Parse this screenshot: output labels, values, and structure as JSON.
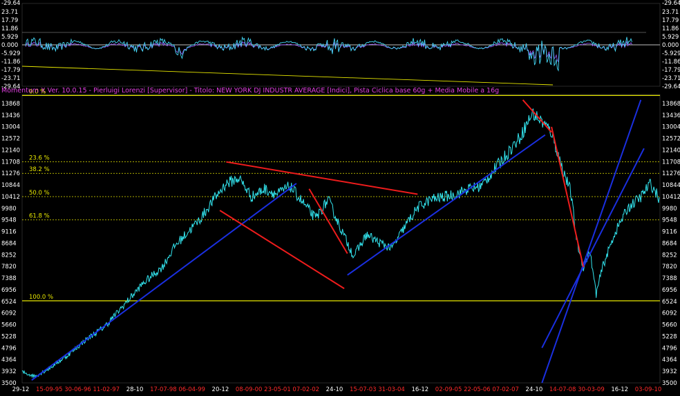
{
  "header": {
    "title": "Momentum X  Ver. 10.0.15  -  Pierluigi Lorenzi  [Supervisor] - Titolo: NEW YORK DJ INDUSTR AVERAGE  [Indici],    Pista Ciclica base 60g + Media Mobile a 16g"
  },
  "colors": {
    "background": "#000000",
    "price": "#33e6f0",
    "trend_blue": "#1a2fe0",
    "trend_red": "#ee1c1c",
    "fib_yellow": "#e8e800",
    "oscillator": "#44d7f5",
    "oscillator_accent": "#9b59ff",
    "label_magenta": "#e040e0",
    "axis_text": "#ffffff",
    "date_red": "#ff2a2a"
  },
  "chart_data": [
    {
      "name": "oscillator",
      "type": "line",
      "yticks": [
        "-29.64",
        "23.71",
        "17.79",
        "11.86",
        "5.929",
        "0.000",
        "-5.929",
        "-11.86",
        "-17.79",
        "-23.71",
        "-29.64"
      ],
      "ylim": [
        -29.64,
        29.64
      ]
    },
    {
      "name": "price",
      "type": "line",
      "yticks": [
        3500,
        3932,
        4364,
        4796,
        5228,
        5660,
        6092,
        6524,
        6956,
        7388,
        7820,
        8252,
        8684,
        9116,
        9548,
        9980,
        10412,
        10844,
        11276,
        11708,
        12140,
        12572,
        13004,
        13436,
        13868
      ],
      "ylim": [
        3500,
        14200
      ],
      "xticks": [
        {
          "label": "29-12",
          "color": "white"
        },
        {
          "label": "15-09-95",
          "color": "red"
        },
        {
          "label": "30-06-96",
          "color": "red"
        },
        {
          "label": "11-02-97",
          "color": "red"
        },
        {
          "label": "28-10",
          "color": "white"
        },
        {
          "label": "17-07-98",
          "color": "red"
        },
        {
          "label": "06-04-99",
          "color": "red"
        },
        {
          "label": "20-12",
          "color": "white"
        },
        {
          "label": "08-09-00",
          "color": "red"
        },
        {
          "label": "23-05-01",
          "color": "red"
        },
        {
          "label": "07-02-02",
          "color": "red"
        },
        {
          "label": "24-10",
          "color": "white"
        },
        {
          "label": "15-07-03",
          "color": "red"
        },
        {
          "label": "31-03-04",
          "color": "red"
        },
        {
          "label": "16-12",
          "color": "white"
        },
        {
          "label": "02-09-05",
          "color": "red"
        },
        {
          "label": "22-05-06",
          "color": "red"
        },
        {
          "label": "07-02-07",
          "color": "red"
        },
        {
          "label": "24-10",
          "color": "white"
        },
        {
          "label": "14-07-08",
          "color": "red"
        },
        {
          "label": "30-03-09",
          "color": "red"
        },
        {
          "label": "16-12",
          "color": "white"
        },
        {
          "label": "03-09-10",
          "color": "red"
        }
      ],
      "fib_levels": [
        {
          "label": "0.0 %",
          "value": 14164
        },
        {
          "label": "23.6 %",
          "value": 11708
        },
        {
          "label": "38.2 %",
          "value": 11276
        },
        {
          "label": "50.0 %",
          "value": 10412
        },
        {
          "label": "61.8 %",
          "value": 9548
        },
        {
          "label": "100.0 %",
          "value": 6547
        }
      ],
      "price_keypoints": [
        [
          0,
          3900
        ],
        [
          0.02,
          3750
        ],
        [
          0.04,
          4000
        ],
        [
          0.07,
          4500
        ],
        [
          0.1,
          5100
        ],
        [
          0.13,
          5600
        ],
        [
          0.16,
          6400
        ],
        [
          0.19,
          7200
        ],
        [
          0.22,
          7800
        ],
        [
          0.24,
          8600
        ],
        [
          0.26,
          9100
        ],
        [
          0.28,
          9600
        ],
        [
          0.3,
          10300
        ],
        [
          0.32,
          10900
        ],
        [
          0.34,
          11100
        ],
        [
          0.36,
          10400
        ],
        [
          0.38,
          10700
        ],
        [
          0.4,
          10500
        ],
        [
          0.42,
          10800
        ],
        [
          0.44,
          10200
        ],
        [
          0.46,
          9600
        ],
        [
          0.48,
          10300
        ],
        [
          0.5,
          9200
        ],
        [
          0.52,
          8200
        ],
        [
          0.54,
          9000
        ],
        [
          0.56,
          8700
        ],
        [
          0.58,
          8500
        ],
        [
          0.6,
          9300
        ],
        [
          0.62,
          10000
        ],
        [
          0.64,
          10300
        ],
        [
          0.66,
          10400
        ],
        [
          0.68,
          10500
        ],
        [
          0.7,
          10700
        ],
        [
          0.72,
          10800
        ],
        [
          0.74,
          11400
        ],
        [
          0.76,
          12000
        ],
        [
          0.78,
          12600
        ],
        [
          0.8,
          13500
        ],
        [
          0.815,
          13200
        ],
        [
          0.83,
          12800
        ],
        [
          0.845,
          11600
        ],
        [
          0.86,
          10600
        ],
        [
          0.87,
          8700
        ],
        [
          0.88,
          7800
        ],
        [
          0.89,
          8400
        ],
        [
          0.9,
          6800
        ],
        [
          0.91,
          7800
        ],
        [
          0.93,
          9100
        ],
        [
          0.95,
          10000
        ],
        [
          0.97,
          10400
        ],
        [
          0.985,
          10900
        ],
        [
          1.0,
          10300
        ]
      ]
    }
  ]
}
